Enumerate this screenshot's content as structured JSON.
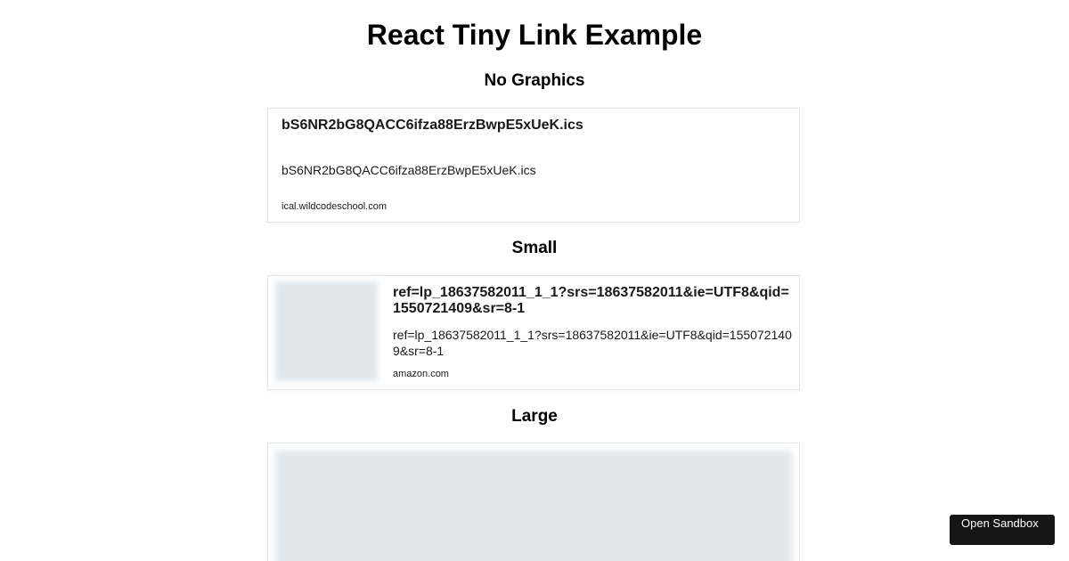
{
  "page": {
    "title": "React Tiny Link Example"
  },
  "sections": [
    {
      "heading": "No Graphics",
      "card": {
        "title": "bS6NR2bG8QACC6ifza88ErzBwpE5xUeK.ics",
        "description": "bS6NR2bG8QACC6ifza88ErzBwpE5xUeK.ics",
        "domain": "ical.wildcodeschool.com"
      }
    },
    {
      "heading": "Small",
      "card": {
        "title": "ref=lp_18637582011_1_1?srs=18637582011&ie=UTF8&qid=1550721409&sr=8-1",
        "description": "ref=lp_18637582011_1_1?srs=18637582011&ie=UTF8&qid=1550721409&sr=8-1",
        "domain": "amazon.com"
      }
    },
    {
      "heading": "Large"
    }
  ],
  "sandbox": {
    "label": "Open Sandbox"
  },
  "colors": {
    "card_border": "#e1e8ed",
    "image_placeholder": "#e1e8ed",
    "sandbox_button_bg": "#151515"
  }
}
